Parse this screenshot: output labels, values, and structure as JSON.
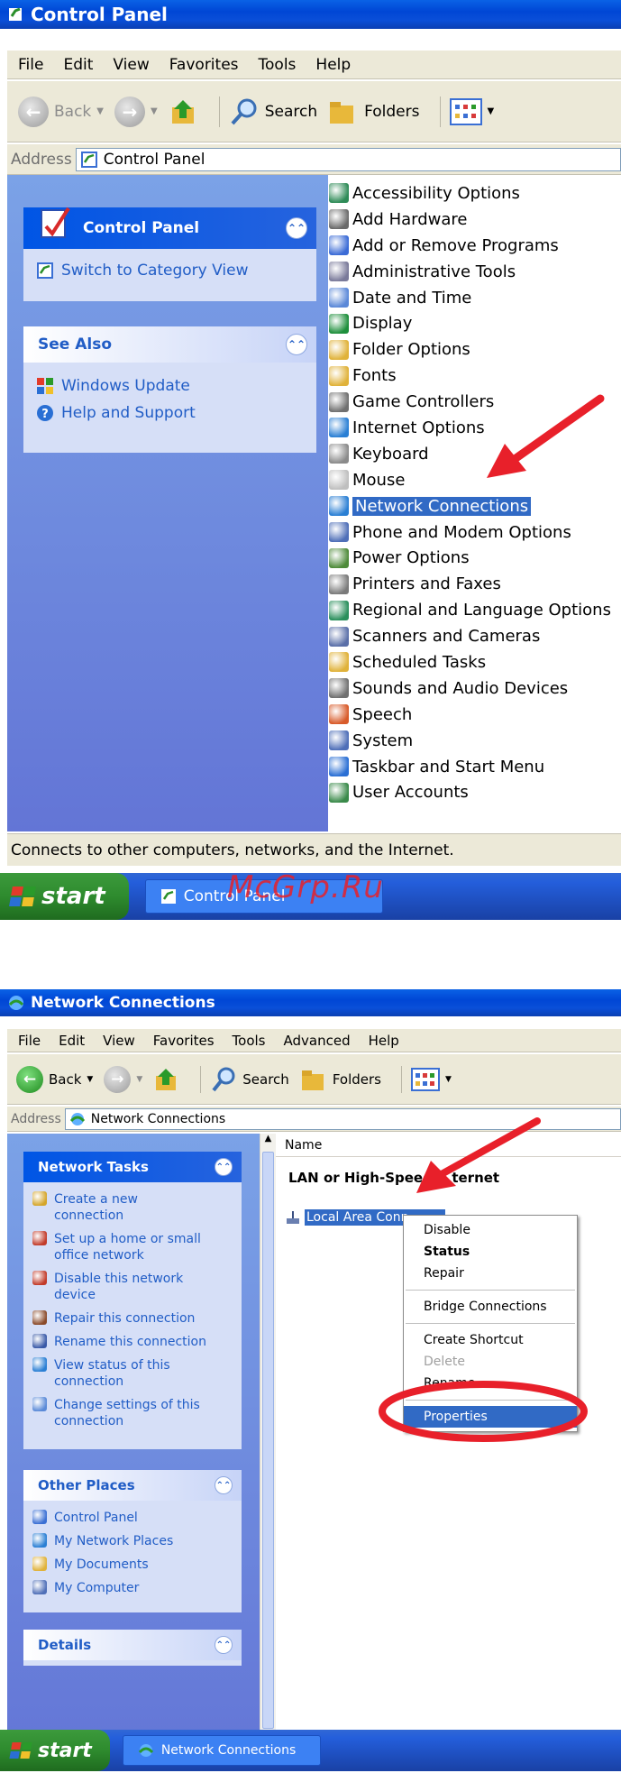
{
  "top": {
    "title": "Control Panel",
    "menu": [
      "File",
      "Edit",
      "View",
      "Favorites",
      "Tools",
      "Help"
    ],
    "toolbar": {
      "back": "Back",
      "search": "Search",
      "folders": "Folders"
    },
    "address": {
      "label": "Address",
      "value": "Control Panel"
    },
    "sidebar": {
      "control_panel": {
        "title": "Control Panel",
        "items": [
          "Switch to Category View"
        ]
      },
      "see_also": {
        "title": "See Also",
        "items": [
          "Windows Update",
          "Help and Support"
        ]
      }
    },
    "items": [
      {
        "label": "Accessibility Options",
        "icon": "accessibility-icon",
        "color": "#2e8b57"
      },
      {
        "label": "Add Hardware",
        "icon": "add-hardware-icon",
        "color": "#6b6b6b"
      },
      {
        "label": "Add or Remove Programs",
        "icon": "add-remove-programs-icon",
        "color": "#3b6bd6"
      },
      {
        "label": "Administrative Tools",
        "icon": "administrative-tools-icon",
        "color": "#7a7a9a"
      },
      {
        "label": "Date and Time",
        "icon": "date-time-icon",
        "color": "#5a88d8"
      },
      {
        "label": "Display",
        "icon": "display-icon",
        "color": "#1e8f3c"
      },
      {
        "label": "Folder Options",
        "icon": "folder-options-icon",
        "color": "#e0b23a"
      },
      {
        "label": "Fonts",
        "icon": "fonts-icon",
        "color": "#e0b23a"
      },
      {
        "label": "Game Controllers",
        "icon": "game-controllers-icon",
        "color": "#707070"
      },
      {
        "label": "Internet Options",
        "icon": "internet-options-icon",
        "color": "#2a7fd4"
      },
      {
        "label": "Keyboard",
        "icon": "keyboard-icon",
        "color": "#8a8a8a"
      },
      {
        "label": "Mouse",
        "icon": "mouse-icon",
        "color": "#bfbfbf"
      },
      {
        "label": "Network Connections",
        "icon": "network-connections-icon",
        "color": "#2a7fd4"
      },
      {
        "label": "Phone and Modem Options",
        "icon": "phone-modem-icon",
        "color": "#4f6fb8"
      },
      {
        "label": "Power Options",
        "icon": "power-options-icon",
        "color": "#4e8b3a"
      },
      {
        "label": "Printers and Faxes",
        "icon": "printers-faxes-icon",
        "color": "#7a7a7a"
      },
      {
        "label": "Regional and Language Options",
        "icon": "regional-language-icon",
        "color": "#2a8f5c"
      },
      {
        "label": "Scanners and Cameras",
        "icon": "scanners-cameras-icon",
        "color": "#5a6fa8"
      },
      {
        "label": "Scheduled Tasks",
        "icon": "scheduled-tasks-icon",
        "color": "#e0b23a"
      },
      {
        "label": "Sounds and Audio Devices",
        "icon": "sounds-audio-icon",
        "color": "#707070"
      },
      {
        "label": "Speech",
        "icon": "speech-icon",
        "color": "#d85b2a"
      },
      {
        "label": "System",
        "icon": "system-icon",
        "color": "#4f6fb8"
      },
      {
        "label": "Taskbar and Start Menu",
        "icon": "taskbar-start-icon",
        "color": "#2a6fd4"
      },
      {
        "label": "User Accounts",
        "icon": "user-accounts-icon",
        "color": "#3a8a4a"
      }
    ],
    "selected": "Network Connections",
    "status": "Connects to other computers, networks, and the Internet.",
    "taskbar": {
      "start": "start",
      "item": "Control Panel"
    }
  },
  "watermark": "McGrp.Ru",
  "bottom": {
    "title": "Network Connections",
    "menu": [
      "File",
      "Edit",
      "View",
      "Favorites",
      "Tools",
      "Advanced",
      "Help"
    ],
    "toolbar": {
      "back": "Back",
      "search": "Search",
      "folders": "Folders"
    },
    "address": {
      "label": "Address",
      "value": "Network Connections"
    },
    "sidebar": {
      "network_tasks": {
        "title": "Network Tasks",
        "items": [
          {
            "line1": "Create a new",
            "line2": "connection",
            "icon": "new-connection-icon",
            "color": "#d4a52a"
          },
          {
            "line1": "Set up a home or small",
            "line2": "office network",
            "icon": "home-network-icon",
            "color": "#c23b2a"
          },
          {
            "line1": "Disable this network",
            "line2": "device",
            "icon": "disable-network-icon",
            "color": "#c23b2a"
          },
          {
            "line1": "Repair this connection",
            "line2": "",
            "icon": "repair-connection-icon",
            "color": "#8a4a2a"
          },
          {
            "line1": "Rename this connection",
            "line2": "",
            "icon": "rename-connection-icon",
            "color": "#3a5aa8"
          },
          {
            "line1": "View status of this",
            "line2": "connection",
            "icon": "view-status-icon",
            "color": "#2a7fd4"
          },
          {
            "line1": "Change settings of this",
            "line2": "connection",
            "icon": "change-settings-icon",
            "color": "#5a8ad8"
          }
        ]
      },
      "other_places": {
        "title": "Other Places",
        "items": [
          {
            "label": "Control Panel",
            "icon": "control-panel-icon",
            "color": "#3a6fd4"
          },
          {
            "label": "My Network Places",
            "icon": "network-places-icon",
            "color": "#2a7fd4"
          },
          {
            "label": "My Documents",
            "icon": "my-documents-icon",
            "color": "#e0b23a"
          },
          {
            "label": "My Computer",
            "icon": "my-computer-icon",
            "color": "#4f6fb8"
          }
        ]
      },
      "details": {
        "title": "Details"
      }
    },
    "list": {
      "column": "Name",
      "group": "LAN or High-Speed Internet",
      "group_hidden": "LAN or High-Speed ",
      "group_tail": "ternet",
      "item": "Local Area Connection",
      "item_visible": "Local Area Conn"
    },
    "context_menu": [
      "Disable",
      "Status",
      "Repair",
      "Bridge Connections",
      "Create Shortcut",
      "Delete",
      "Rename",
      "Properties"
    ],
    "taskbar": {
      "start": "start",
      "item": "Network Connections"
    },
    "colors": {
      "highlight": "#316ac5",
      "annotation": "#e8202a"
    }
  }
}
